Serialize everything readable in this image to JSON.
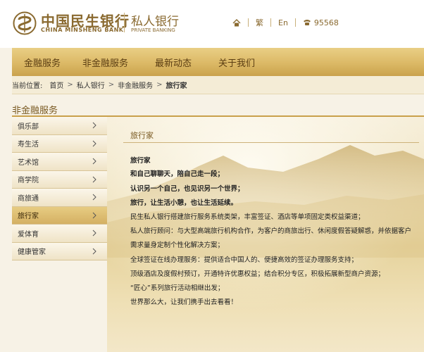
{
  "header": {
    "bank_name_cn": "中国民生银行",
    "bank_name_en": "CHINA MINSHENG BANK",
    "private_banking_cn": "私人银行",
    "private_banking_en": "PRIVATE BANKING",
    "tools": {
      "home_icon": "home-icon",
      "traditional_label": "繁",
      "english_label": "En",
      "phone_icon": "phone-icon",
      "phone_number": "95568"
    }
  },
  "nav": {
    "items": [
      {
        "label": "金融服务"
      },
      {
        "label": "非金融服务"
      },
      {
        "label": "最新动态"
      },
      {
        "label": "关于我们"
      }
    ]
  },
  "breadcrumb": {
    "prefix": "当前位置:",
    "items": [
      "首页",
      "私人银行",
      "非金融服务",
      "旅行家"
    ]
  },
  "section": {
    "title": "非金融服务"
  },
  "sidebar": {
    "items": [
      {
        "label": "俱乐部",
        "active": false
      },
      {
        "label": "寿生活",
        "active": false
      },
      {
        "label": "艺术馆",
        "active": false
      },
      {
        "label": "商学院",
        "active": false
      },
      {
        "label": "商旅通",
        "active": false
      },
      {
        "label": "旅行家",
        "active": true
      },
      {
        "label": "爱体育",
        "active": false
      },
      {
        "label": "健康管家",
        "active": false
      }
    ]
  },
  "content": {
    "title": "旅行家",
    "paragraphs": [
      {
        "text": "旅行家",
        "bold": true
      },
      {
        "text": "和自己聊聊天，陪自己走一段；",
        "bold": true
      },
      {
        "text": "认识另一个自己，也见识另一个世界；",
        "bold": true
      },
      {
        "text": "旅行，让生活小憩，也让生活延续。",
        "bold": true
      },
      {
        "text": "民生私人银行搭建旅行服务系统类架，丰富签证、酒店等单项固定类权益渠道；",
        "bold": false
      },
      {
        "text": "私人旅行顾问：与大型高端旅行机构合作，为客户的商旅出行、休闲度假答疑解惑，并依据客户",
        "bold": false
      },
      {
        "text": "需求量身定制个性化解决方案；",
        "bold": false
      },
      {
        "text": "全球签证在线办理服务：提供适合中国人的、便捷高效的签证办理服务支持；",
        "bold": false
      },
      {
        "text": "顶级酒店及度假村预订，开通特许优惠权益；结合积分专区，积极拓展新型商户资源；",
        "bold": false
      },
      {
        "text": "“匠心”系列旅行活动相继出发；",
        "bold": false
      },
      {
        "text": "世界那么大，让我们携手出去看看！",
        "bold": false
      }
    ]
  },
  "colors": {
    "brand_gold": "#8a6a30",
    "nav_gold": "#dcb966",
    "active_item": "#d4b063"
  }
}
